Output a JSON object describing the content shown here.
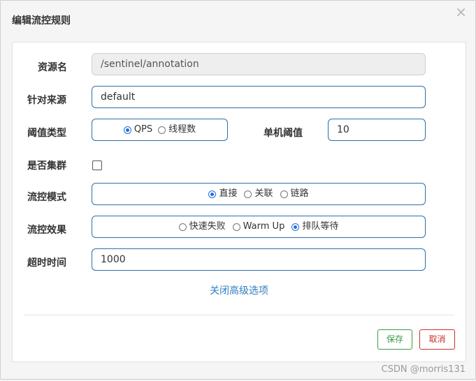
{
  "dialog": {
    "title": "编辑流控规则",
    "close_glyph": "×"
  },
  "form": {
    "resource_name": {
      "label": "资源名",
      "value": "/sentinel/annotation"
    },
    "limit_app": {
      "label": "针对来源",
      "value": "default"
    },
    "threshold_type": {
      "label": "阈值类型",
      "options": [
        {
          "label": "QPS",
          "selected": true
        },
        {
          "label": "线程数",
          "selected": false
        }
      ]
    },
    "single_threshold": {
      "label": "单机阈值",
      "value": "10"
    },
    "cluster": {
      "label": "是否集群",
      "checked": false
    },
    "flow_mode": {
      "label": "流控模式",
      "options": [
        {
          "label": "直接",
          "selected": true
        },
        {
          "label": "关联",
          "selected": false
        },
        {
          "label": "链路",
          "selected": false
        }
      ]
    },
    "flow_effect": {
      "label": "流控效果",
      "options": [
        {
          "label": "快速失败",
          "selected": false
        },
        {
          "label": "Warm Up",
          "selected": false
        },
        {
          "label": "排队等待",
          "selected": true
        }
      ]
    },
    "timeout": {
      "label": "超时时间",
      "value": "1000"
    },
    "advanced_link": "关闭高级选项"
  },
  "footer": {
    "save_label": "保存",
    "cancel_label": "取消"
  },
  "watermark": "CSDN @morris131",
  "colors": {
    "accent_blue": "#2d6ea8",
    "save_green": "#3b9a48",
    "cancel_red": "#c9302c",
    "link_blue": "#2f7ec1"
  }
}
